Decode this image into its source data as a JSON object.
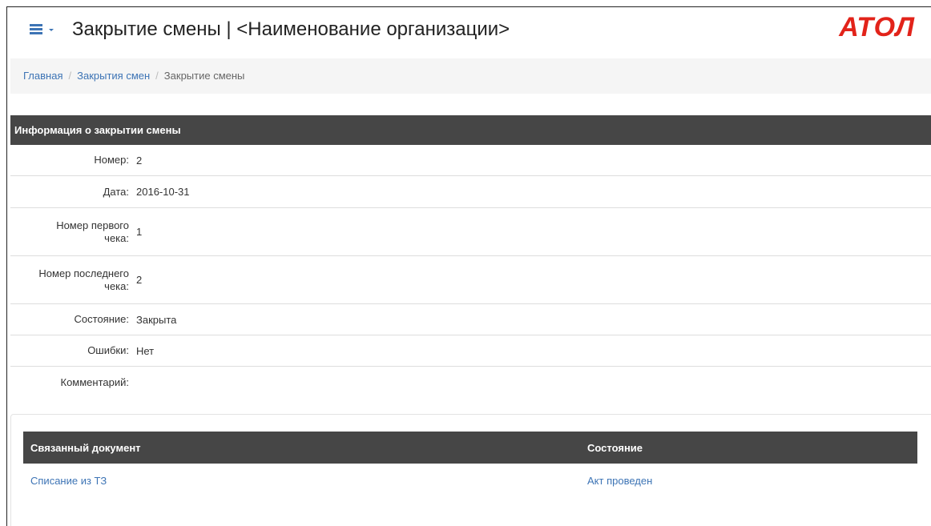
{
  "header": {
    "title": "Закрытие смены | <Наименование организации>",
    "logo_text": "АТОЛ",
    "menu_icon": "hamburger-icon"
  },
  "breadcrumb": {
    "items": [
      "Главная",
      "Закрытия смен"
    ],
    "current": "Закрытие смены",
    "separator": "/"
  },
  "info": {
    "title": "Информация о закрытии смены",
    "rows": [
      {
        "label": "Номер:",
        "value": "2"
      },
      {
        "label": "Дата:",
        "value": "2016-10-31"
      },
      {
        "label": "Номер первого чека:",
        "value": "1"
      },
      {
        "label": "Номер последнего чека:",
        "value": "2"
      },
      {
        "label": "Состояние:",
        "value": "Закрыта"
      },
      {
        "label": "Ошибки:",
        "value": "Нет"
      },
      {
        "label": "Комментарий:",
        "value": ""
      }
    ]
  },
  "related": {
    "columns": [
      "Связанный документ",
      "Состояние"
    ],
    "rows": [
      {
        "document": "Списание из ТЗ",
        "status": "Акт проведен"
      }
    ]
  },
  "colors": {
    "link": "#3d74b5",
    "header_bg": "#464646",
    "brand": "#e2231a"
  }
}
